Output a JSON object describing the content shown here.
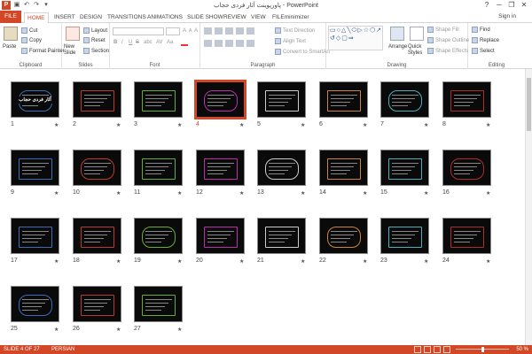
{
  "window": {
    "title": "پاورپوینت آثار فردی حجاب - PowerPoint",
    "sign_in": "Sign in",
    "help": "?",
    "minimize": "─",
    "restore": "❐",
    "close": "✕"
  },
  "qat": {
    "logo": "P",
    "save": "▣",
    "undo": "↶",
    "redo": "↷",
    "customize": "▾"
  },
  "tabs": [
    {
      "label": "FILE"
    },
    {
      "label": "HOME"
    },
    {
      "label": "INSERT"
    },
    {
      "label": "DESIGN"
    },
    {
      "label": "TRANSITIONS"
    },
    {
      "label": "ANIMATIONS"
    },
    {
      "label": "SLIDE SHOW"
    },
    {
      "label": "REVIEW"
    },
    {
      "label": "VIEW"
    },
    {
      "label": "FILEminimizer"
    }
  ],
  "ribbon": {
    "clipboard": {
      "label": "Clipboard",
      "paste": "Paste",
      "cut": "Cut",
      "copy": "Copy",
      "format_painter": "Format Painter"
    },
    "slides": {
      "label": "Slides",
      "new_slide": "New Slide",
      "layout": "Layout",
      "reset": "Reset",
      "section": "Section"
    },
    "font": {
      "label": "Font",
      "bold": "B",
      "italic": "I",
      "underline": "U",
      "strike": "S",
      "shadow": "abc",
      "spacing": "AV",
      "case": "Aa",
      "grow": "A",
      "shrink": "A",
      "clear": "A"
    },
    "paragraph": {
      "label": "Paragraph",
      "text_direction": "Text Direction",
      "align_text": "Align Text",
      "convert": "Convert to SmartArt"
    },
    "drawing": {
      "label": "Drawing",
      "shapes": "▭○△╲⬭▷☆⬡↗{}↺◇▢⇒",
      "arrange": "Arrange",
      "quick_styles": "Quick Styles",
      "shape_fill": "Shape Fill",
      "shape_outline": "Shape Outline",
      "shape_effects": "Shape Effects"
    },
    "editing": {
      "label": "Editing",
      "find": "Find",
      "replace": "Replace",
      "select": "Select"
    }
  },
  "slides": [
    {
      "n": "1",
      "title": "آثار فردی حجاب"
    },
    {
      "n": "2"
    },
    {
      "n": "3"
    },
    {
      "n": "4"
    },
    {
      "n": "5"
    },
    {
      "n": "6"
    },
    {
      "n": "7"
    },
    {
      "n": "8"
    },
    {
      "n": "9"
    },
    {
      "n": "10"
    },
    {
      "n": "11"
    },
    {
      "n": "12"
    },
    {
      "n": "13"
    },
    {
      "n": "14"
    },
    {
      "n": "15"
    },
    {
      "n": "16"
    },
    {
      "n": "17"
    },
    {
      "n": "18"
    },
    {
      "n": "19"
    },
    {
      "n": "20"
    },
    {
      "n": "21"
    },
    {
      "n": "22"
    },
    {
      "n": "23"
    },
    {
      "n": "24"
    },
    {
      "n": "25"
    },
    {
      "n": "26"
    },
    {
      "n": "27"
    }
  ],
  "selected_slide": "4",
  "slide_star": "★",
  "status": {
    "slide_info": "SLIDE 4 OF 27",
    "language": "PERSIAN",
    "zoom": "50 %"
  },
  "colors": {
    "accent": "#d24726",
    "slide_bg": "#0a0a0a"
  }
}
